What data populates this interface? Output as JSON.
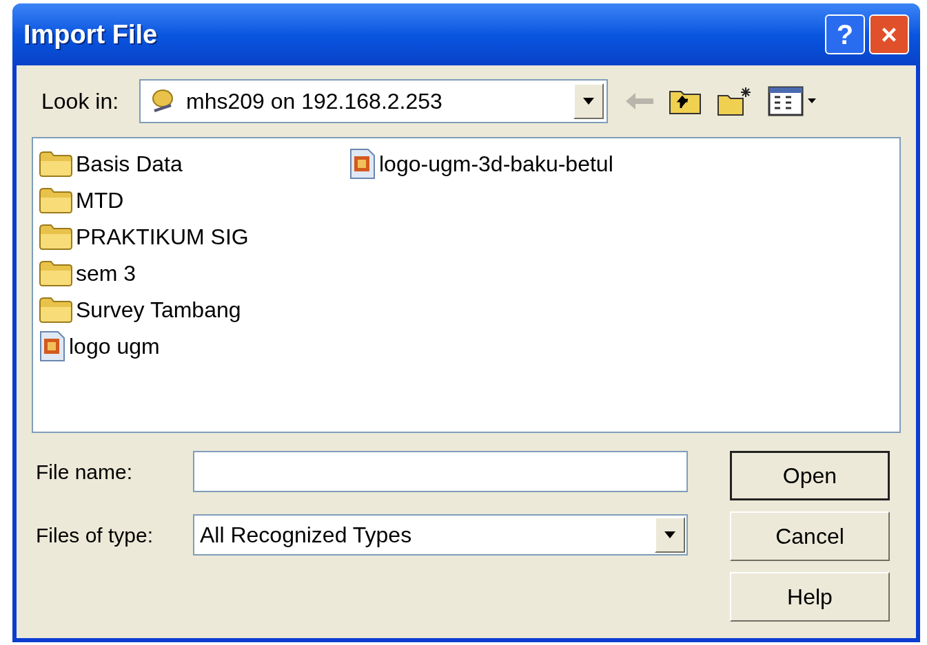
{
  "window": {
    "title": "Import File",
    "title_buttons": [
      "?",
      "×"
    ]
  },
  "look_in": {
    "label": "Look in:",
    "value": "mhs209 on 192.168.2.253"
  },
  "files": [
    {
      "name": "Basis Data",
      "kind": "folder"
    },
    {
      "name": "MTD",
      "kind": "folder"
    },
    {
      "name": "PRAKTIKUM SIG",
      "kind": "folder"
    },
    {
      "name": "sem 3",
      "kind": "folder"
    },
    {
      "name": "Survey Tambang",
      "kind": "folder"
    },
    {
      "name": "logo ugm",
      "kind": "image"
    },
    {
      "name": "logo-ugm-3d-baku-betul",
      "kind": "image"
    }
  ],
  "file_name": {
    "label": "File name:"
  },
  "file_type": {
    "label": "Files of type:",
    "value": "All Recognized Types"
  },
  "buttons": [
    {
      "label": "Open",
      "default": true
    },
    {
      "label": "Cancel",
      "default": false
    },
    {
      "label": "Help",
      "default": false
    }
  ]
}
